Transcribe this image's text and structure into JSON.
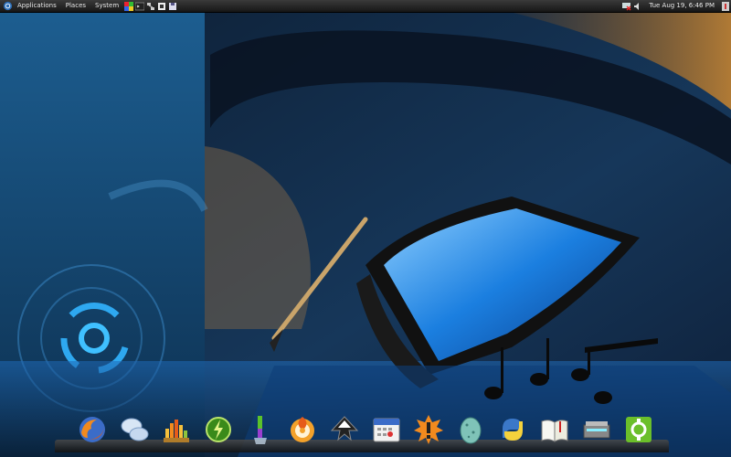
{
  "top_panel": {
    "menus": [
      "Applications",
      "Places",
      "System"
    ],
    "clock": "Tue Aug 19,  6:46 PM"
  },
  "launcher_icons": [
    "firefox-icon",
    "pidgin-icon",
    "system-monitor-icon",
    "power-icon",
    "pencil-icon",
    "brasero-icon",
    "inkscape-icon",
    "calendar-icon",
    "update-notifier-icon",
    "egg-icon",
    "python-icon",
    "book-icon",
    "scanner-icon",
    "settings-icon"
  ],
  "colors": {
    "panel": "#1e1e1e",
    "accent": "#1e8fe0",
    "wallpaper_dark": "#0a1a2e"
  }
}
